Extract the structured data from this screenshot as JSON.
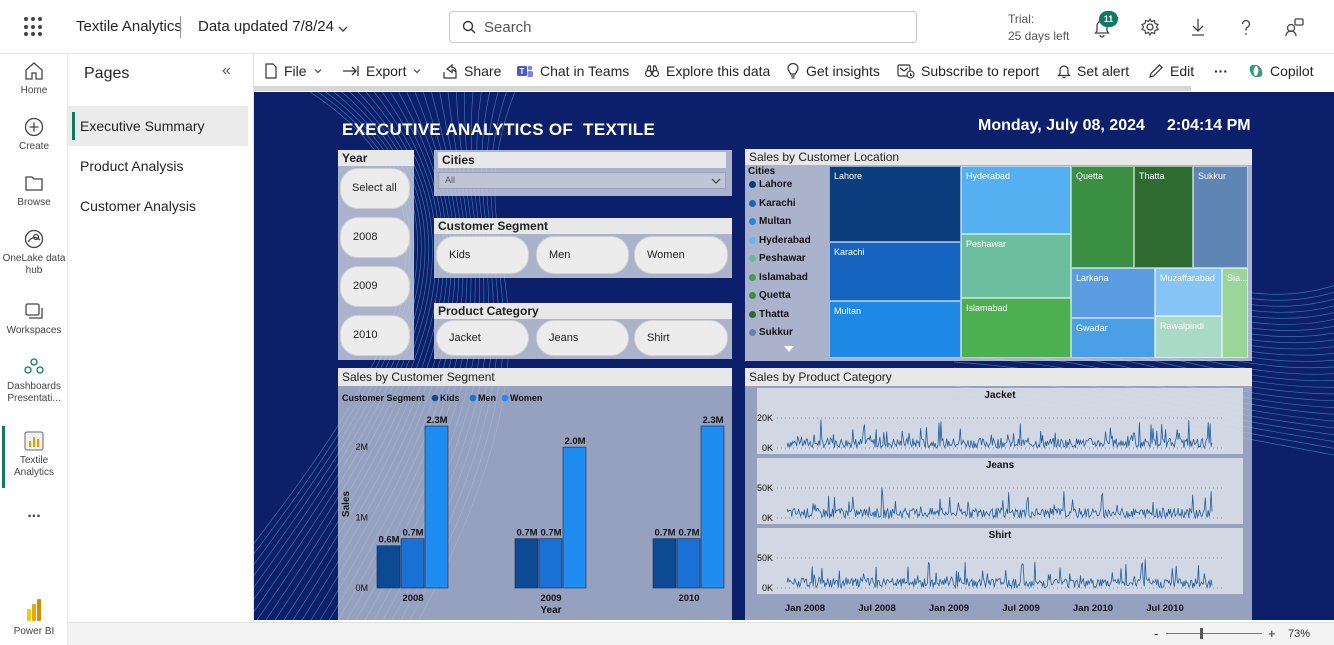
{
  "topbar": {
    "app_title": "Textile Analytics",
    "data_updated": "Data updated 7/8/24",
    "search_placeholder": "Search",
    "trial_label": "Trial:",
    "trial_days": "25 days left",
    "notification_count": "11"
  },
  "rail": {
    "items": [
      {
        "label": "Home",
        "icon": "home-icon"
      },
      {
        "label": "Create",
        "icon": "plus-circle-icon"
      },
      {
        "label": "Browse",
        "icon": "folder-icon"
      },
      {
        "label": "OneLake data hub",
        "icon": "onelake-icon"
      },
      {
        "label": "Workspaces",
        "icon": "workspaces-icon"
      },
      {
        "label": "Dashboards Presentati...",
        "icon": "dashboards-icon"
      },
      {
        "label": "Textile Analytics",
        "icon": "report-icon"
      },
      {
        "label": "Power BI",
        "icon": "powerbi-logo-icon"
      }
    ],
    "more_label": "..."
  },
  "pages_panel": {
    "title": "Pages",
    "collapse_glyph": "«",
    "pages": [
      "Executive Summary",
      "Product Analysis",
      "Customer Analysis"
    ],
    "active_index": 0
  },
  "actions": {
    "file": "File",
    "export": "Export",
    "share": "Share",
    "chat_in_teams": "Chat in Teams",
    "explore": "Explore this data",
    "insights": "Get insights",
    "subscribe": "Subscribe to report",
    "alert": "Set alert",
    "edit": "Edit",
    "more": "···",
    "copilot": "Copilot"
  },
  "report": {
    "title": "EXECUTIVE ANALYTICS OF  TEXTILE",
    "date": "Monday, July 08, 2024",
    "time": "2:04:14 PM",
    "year_slicer": {
      "title": "Year",
      "options": [
        "Select all",
        "2008",
        "2009",
        "2010"
      ]
    },
    "cities_slicer": {
      "title": "Cities",
      "value": "All"
    },
    "segment_slicer": {
      "title": "Customer Segment",
      "options": [
        "Kids",
        "Men",
        "Women"
      ]
    },
    "category_slicer": {
      "title": "Product Category",
      "options": [
        "Jacket",
        "Jeans",
        "Shirt"
      ]
    },
    "treemap": {
      "title": "Sales by Customer Location",
      "legend_title": "Cities",
      "legend": [
        {
          "name": "Lahore",
          "color": "#0b3c7d"
        },
        {
          "name": "Karachi",
          "color": "#1565c0"
        },
        {
          "name": "Multan",
          "color": "#1e88e5"
        },
        {
          "name": "Hyderabad",
          "color": "#64b5f6"
        },
        {
          "name": "Peshawar",
          "color": "#66bb9a"
        },
        {
          "name": "Islamabad",
          "color": "#43a047"
        },
        {
          "name": "Quetta",
          "color": "#388e3c"
        },
        {
          "name": "Thatta",
          "color": "#2e6b30"
        },
        {
          "name": "Sukkur",
          "color": "#5e85b3"
        }
      ],
      "tiles": [
        "Lahore",
        "Karachi",
        "Multan",
        "Hyderabad",
        "Peshawar",
        "Islamabad",
        "Quetta",
        "Thatta",
        "Sukkur",
        "Larkana",
        "Muzaffarabad",
        "Sia...",
        "Gwadar",
        "Rawalpindi"
      ]
    }
  },
  "chart_data": [
    {
      "type": "bar",
      "title": "Sales by Customer Segment",
      "legend_title": "Customer Segment",
      "categories": [
        "2008",
        "2009",
        "2010"
      ],
      "xlabel": "Year",
      "ylabel": "Sales",
      "ylim": [
        0,
        2300000
      ],
      "yticks": [
        "0M",
        "1M",
        "2M"
      ],
      "series": [
        {
          "name": "Kids",
          "color": "#0d4a94",
          "values": [
            600000,
            700000,
            700000
          ],
          "labels": [
            "0.6M",
            "0.7M",
            "0.7M"
          ]
        },
        {
          "name": "Men",
          "color": "#1971d6",
          "values": [
            700000,
            700000,
            700000
          ],
          "labels": [
            "0.7M",
            "0.7M",
            "0.7M"
          ]
        },
        {
          "name": "Women",
          "color": "#1e8cf0",
          "values": [
            2300000,
            2000000,
            2300000
          ],
          "labels": [
            "2.3M",
            "2.0M",
            "2.3M"
          ]
        }
      ]
    },
    {
      "type": "line",
      "title": "Sales by Product Category",
      "x_ticks": [
        "Jan 2008",
        "Jul 2008",
        "Jan 2009",
        "Jul 2009",
        "Jan 2010",
        "Jul 2010"
      ],
      "panels": [
        {
          "name": "Jacket",
          "yticks": [
            "0K",
            "20K"
          ],
          "ymax": 25000
        },
        {
          "name": "Jeans",
          "yticks": [
            "0K",
            "50K"
          ],
          "ymax": 60000
        },
        {
          "name": "Shirt",
          "yticks": [
            "0K",
            "50K"
          ],
          "ymax": 60000
        }
      ]
    }
  ],
  "status": {
    "zoom_minus": "-",
    "zoom_plus": "+",
    "zoom": "73%",
    "zoom_level": 0.35
  }
}
